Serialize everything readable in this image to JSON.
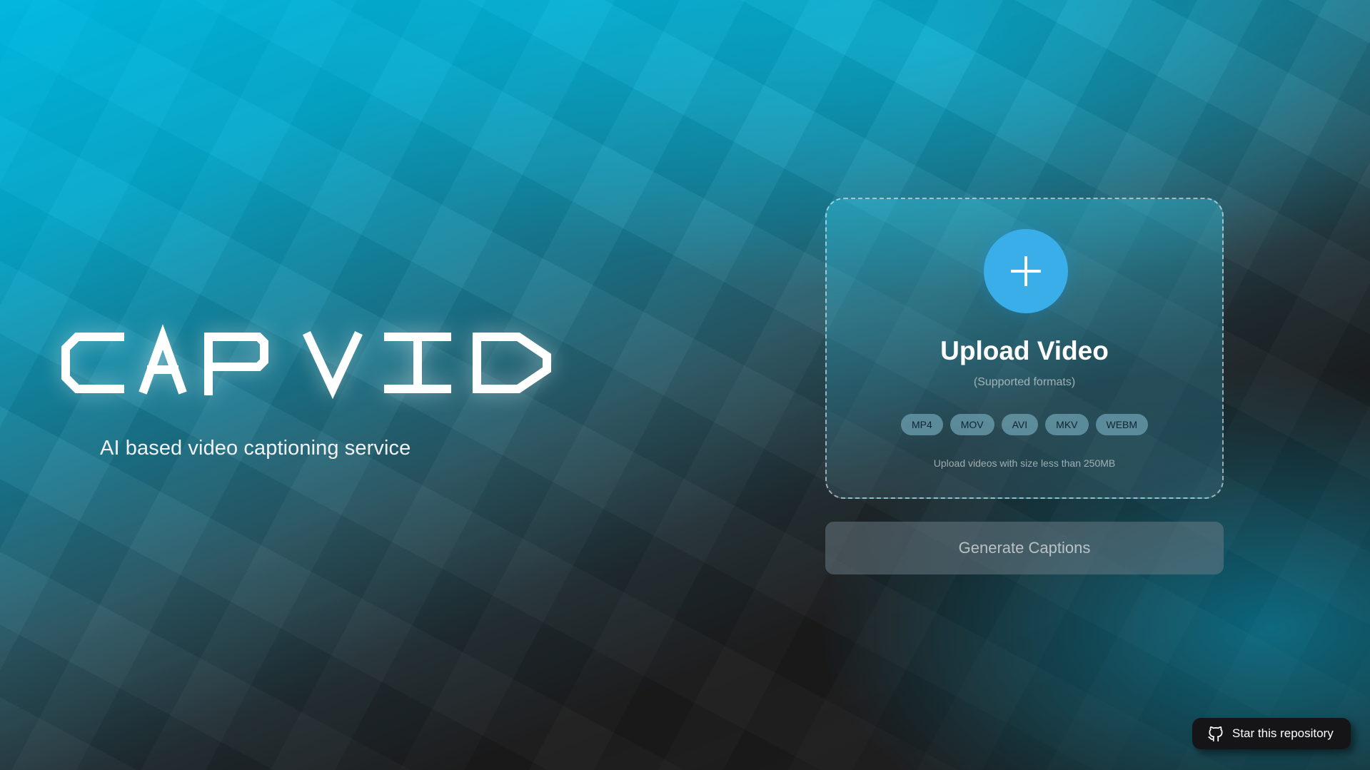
{
  "brand": {
    "logo_text": "CAPVID",
    "tagline": "AI based video captioning service"
  },
  "upload": {
    "icon": "plus-icon",
    "title": "Upload Video",
    "supported_label": "(Supported formats)",
    "formats": [
      "MP4",
      "MOV",
      "AVI",
      "MKV",
      "WEBM"
    ],
    "size_note": "Upload videos with size less than 250MB"
  },
  "actions": {
    "generate_label": "Generate Captions"
  },
  "footer": {
    "star_icon": "github-icon",
    "star_label": "Star this repository"
  },
  "colors": {
    "accent": "#3aaee8",
    "background_top": "#00b8e0",
    "background_bottom": "#1c1c1c"
  }
}
